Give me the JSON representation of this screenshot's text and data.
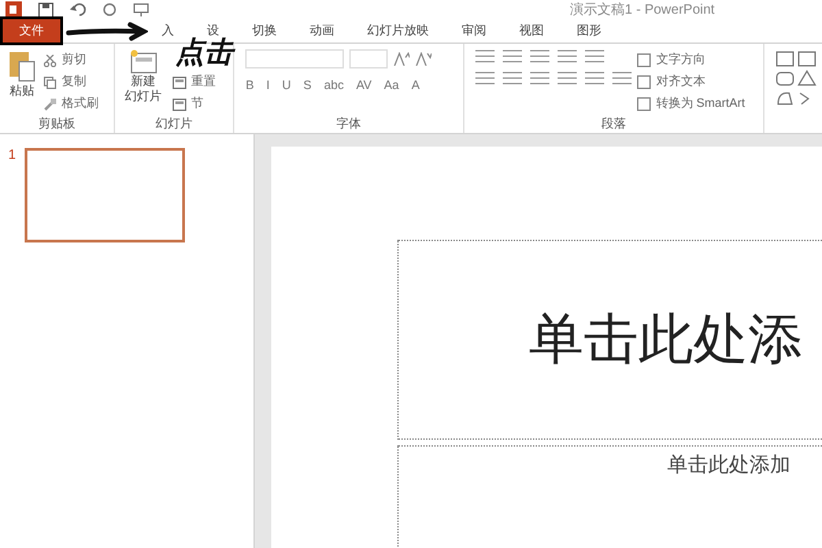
{
  "window": {
    "title": "演示文稿1 - PowerPoint"
  },
  "tabs": [
    {
      "label": "文件",
      "kind": "file",
      "selected": false
    },
    {
      "label": "入",
      "kind": "tab",
      "selected": false
    },
    {
      "label": "设",
      "kind": "tab",
      "selected": false
    },
    {
      "label": "切换",
      "kind": "tab",
      "selected": false
    },
    {
      "label": "动画",
      "kind": "tab",
      "selected": false
    },
    {
      "label": "幻灯片放映",
      "kind": "tab",
      "selected": false
    },
    {
      "label": "审阅",
      "kind": "tab",
      "selected": false
    },
    {
      "label": "视图",
      "kind": "tab",
      "selected": false
    },
    {
      "label": "图形",
      "kind": "tab",
      "selected": false
    }
  ],
  "annotation": {
    "text": "点击"
  },
  "ribbon": {
    "clipboard": {
      "paste": "粘贴",
      "cut": "剪切",
      "copy": "复制",
      "format_painter": "格式刷",
      "label": "剪贴板"
    },
    "slides": {
      "new_slide": [
        "新建",
        "幻灯片"
      ],
      "reset": "重置",
      "section": "节",
      "label": "幻灯片"
    },
    "font": {
      "label": "字体",
      "buttons": [
        "B",
        "I",
        "U",
        "S",
        "abc",
        "AV",
        "Aa",
        "A"
      ]
    },
    "paragraph": {
      "text_direction": "文字方向",
      "align_text": "对齐文本",
      "smartart": "转换为 SmartArt",
      "label": "段落"
    }
  },
  "thumbnails": [
    {
      "number": "1",
      "selected": true
    }
  ],
  "slide": {
    "title_placeholder": "单击此处添",
    "subtitle_placeholder": "单击此处添加"
  }
}
